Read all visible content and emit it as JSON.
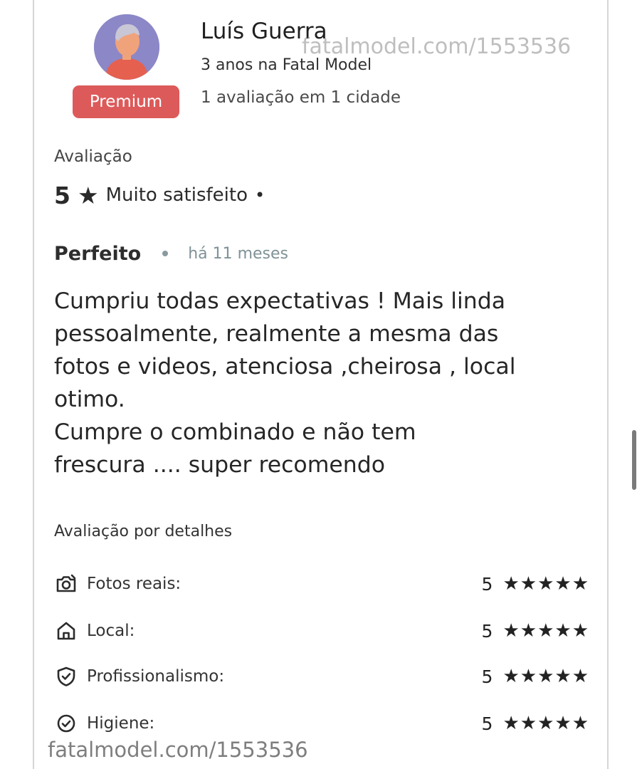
{
  "reviewer": {
    "name": "Luís Guerra",
    "tenure": "3 anos na Fatal Model",
    "badge": "Premium",
    "review_count": "1 avaliação em 1 cidade"
  },
  "watermark": "fatalmodel.com/1553536",
  "rating": {
    "heading": "Avaliação",
    "value": "5",
    "star": "★",
    "description": "Muito satisfeito",
    "separator": "•"
  },
  "review": {
    "title": "Perfeito",
    "time": "há 11 meses",
    "body_lines": [
      "Cumpriu todas expectativas ! Mais linda",
      "pessoalmente, realmente a mesma das",
      "fotos e videos, atenciosa ,cheirosa , local",
      "otimo.",
      "Cumpre o combinado e não tem",
      "frescura .... super recomendo"
    ]
  },
  "details": {
    "heading": "Avaliação por detalhes",
    "items": [
      {
        "icon": "camera-icon",
        "label": "Fotos reais:",
        "score": "5",
        "stars": "★★★★★"
      },
      {
        "icon": "home-icon",
        "label": "Local:",
        "score": "5",
        "stars": "★★★★★"
      },
      {
        "icon": "shield-check-icon",
        "label": "Profissionalismo:",
        "score": "5",
        "stars": "★★★★★"
      },
      {
        "icon": "check-circle-icon",
        "label": "Higiene:",
        "score": "5",
        "stars": "★★★★★"
      }
    ]
  },
  "colors": {
    "premium_badge": "#dd5a5a",
    "avatar_background": "#8c87c7",
    "text_primary": "#2b2b2b",
    "text_muted": "#7f9297"
  }
}
